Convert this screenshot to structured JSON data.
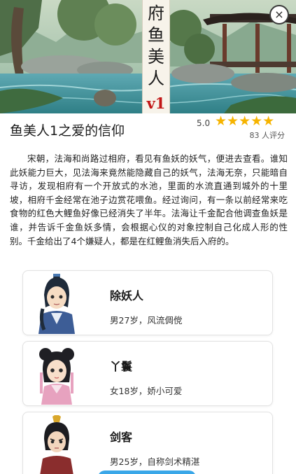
{
  "banner": {
    "title_chars": [
      "府",
      "鱼",
      "美",
      "人"
    ],
    "version": "v1",
    "close_icon": "×"
  },
  "story": {
    "title": "鱼美人1之爱的信仰",
    "rating_score": "5.0",
    "stars": "★★★★★",
    "star_color": "#f6b400",
    "star_count": 5,
    "rating_count": "83 人评分",
    "description": "宋朝，法海和尚路过相府，看见有鱼妖的妖气，便进去查看。谁知此妖能力巨大，见法海来竟然能隐藏自己的妖气，法海无奈，只能暗自寻访，发现相府有一个开放式的水池，里面的水流直通到城外的十里坡，相府千金经常在池子边赏花喂鱼。经过询问，有一条以前经常来吃食物的红色大鲤鱼好像已经消失了半年。法海让千金配合他调查鱼妖是谁，并告诉千金鱼妖多情，会根据心仪的对象控制自己化成人形的性别。千金给出了4个嫌疑人，都是在红鲤鱼消失后入府的。"
  },
  "characters": [
    {
      "name": "除妖人",
      "desc": "男27岁，风流倜傥"
    },
    {
      "name": "丫鬟",
      "desc": "女18岁，娇小可爱"
    },
    {
      "name": "剑客",
      "desc": "男25岁，自称剑术精湛"
    }
  ],
  "colors": {
    "accent": "#3aa7e8",
    "version_red": "#c21717"
  }
}
